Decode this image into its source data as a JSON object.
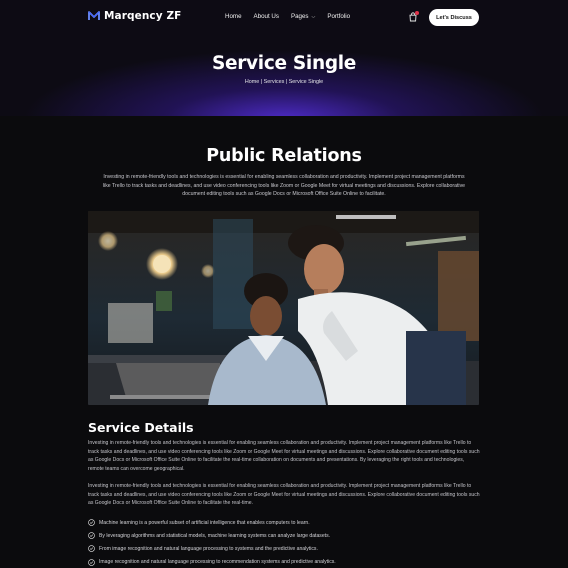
{
  "brand": {
    "name": "Marqency ZF"
  },
  "nav": {
    "items": [
      {
        "label": "Home"
      },
      {
        "label": "About Us"
      },
      {
        "label": "Pages",
        "has_dropdown": true
      },
      {
        "label": "Portfolio"
      }
    ],
    "cart_icon": "shopping-bag-icon",
    "cta_label": "Let's Discuss"
  },
  "hero": {
    "title": "Service Single",
    "breadcrumb": [
      "Home",
      "Services",
      "Service Single"
    ],
    "separator": " | "
  },
  "main": {
    "title": "Public Relations",
    "intro": "Investing in remote-friendly tools and technologies is essential for enabling seamless collaboration and productivity. Implement project management platforms like Trello to track tasks and deadlines, and use video conferencing tools like Zoom or Google Meet for virtual meetings and discussions. Explore collaborative document editing tools such as Google Docs or Microsoft Office Suite Online to facilitate.",
    "image_alt": "two people looking at a laptop"
  },
  "details": {
    "title": "Service Details",
    "paragraphs": [
      "Investing in remote-friendly tools and technologies is essential for enabling seamless collaboration and productivity. Implement project management platforms like Trello to track tasks and deadlines, and use video conferencing tools like Zoom or Google Meet for virtual meetings and discussions. Explore collaborative document editing tools such as Google Docs or Microsoft Office Suite Online to facilitate the real-time collaboration on documents and presentations. By leveraging the right tools and technologies, remote teams can overcome geographical.",
      "Investing in remote-friendly tools and technologies is essential for enabling seamless collaboration and productivity. Implement project management platforms like Trello to track tasks and deadlines, and use video conferencing tools like Zoom or Google Meet for virtual meetings and discussions. Explore collaborative document editing tools such as Google Docs or Microsoft Office Suite Online to facilitate the real-time."
    ],
    "checklist": [
      "Machine learning is a powerful subset of artificial intelligence that enables computers to learn.",
      "By leveraging algorithms and statistical models, machine learning systems can analyze large datasets.",
      "From image recognition and natural language processing to systems and the predictive analytics.",
      "Image recognition and natural language processing to recommendation systems and predictive analytics."
    ]
  },
  "colors": {
    "accent": "#5a31e6",
    "background": "#0b0b0d",
    "badge": "#e0344b"
  }
}
